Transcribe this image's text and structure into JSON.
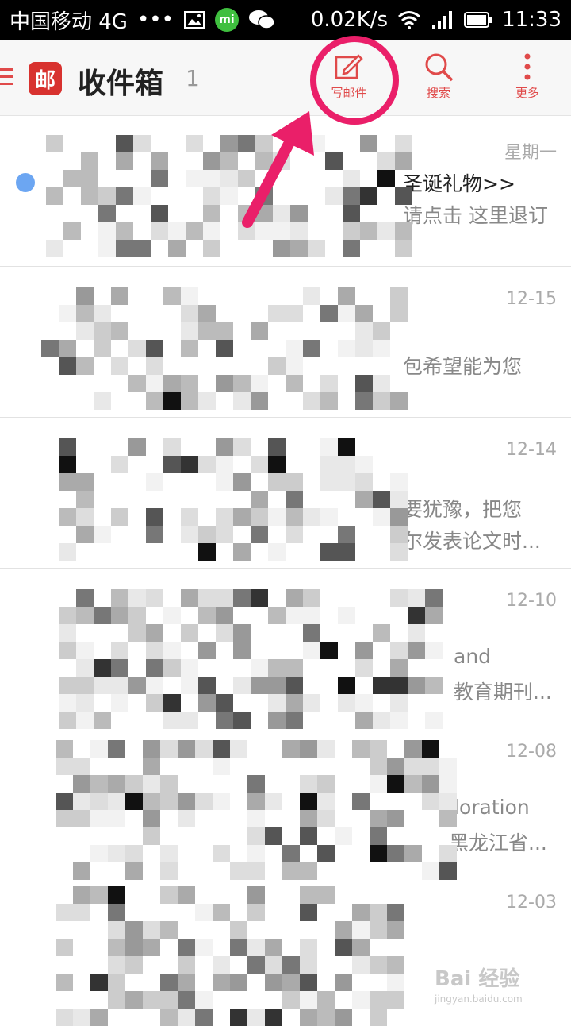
{
  "status_bar": {
    "carrier": "中国移动 4G",
    "dots": "•••",
    "mi_label": "mi",
    "speed": "0.02K/s",
    "time": "11:33"
  },
  "app_bar": {
    "logo": "邮",
    "title": "收件箱",
    "count": "1",
    "compose_label": "写邮件",
    "search_label": "搜索",
    "more_label": "更多"
  },
  "emails": [
    {
      "date": "星期一",
      "line1": "圣诞礼物>>",
      "line2": "请点击 这里退订",
      "unread": true
    },
    {
      "date": "12-15",
      "line1": "",
      "line2": "包希望能为您",
      "unread": false
    },
    {
      "date": "12-14",
      "line1": "要犹豫，把您",
      "line2": "尔发表论文时...",
      "unread": false
    },
    {
      "date": "12-10",
      "line1": "and",
      "line2": "教育期刊...",
      "unread": false
    },
    {
      "date": "12-08",
      "line1": "loration",
      "line2": "黑龙江省...",
      "unread": false
    },
    {
      "date": "12-03",
      "line1": "",
      "line2": "",
      "unread": false
    }
  ],
  "watermark": {
    "brand": "Bai 经验",
    "url": "jingyan.baidu.com"
  },
  "colors": {
    "accent": "#e04a4a",
    "highlight": "#ea1f69",
    "unread_dot": "#6ca6f2"
  }
}
